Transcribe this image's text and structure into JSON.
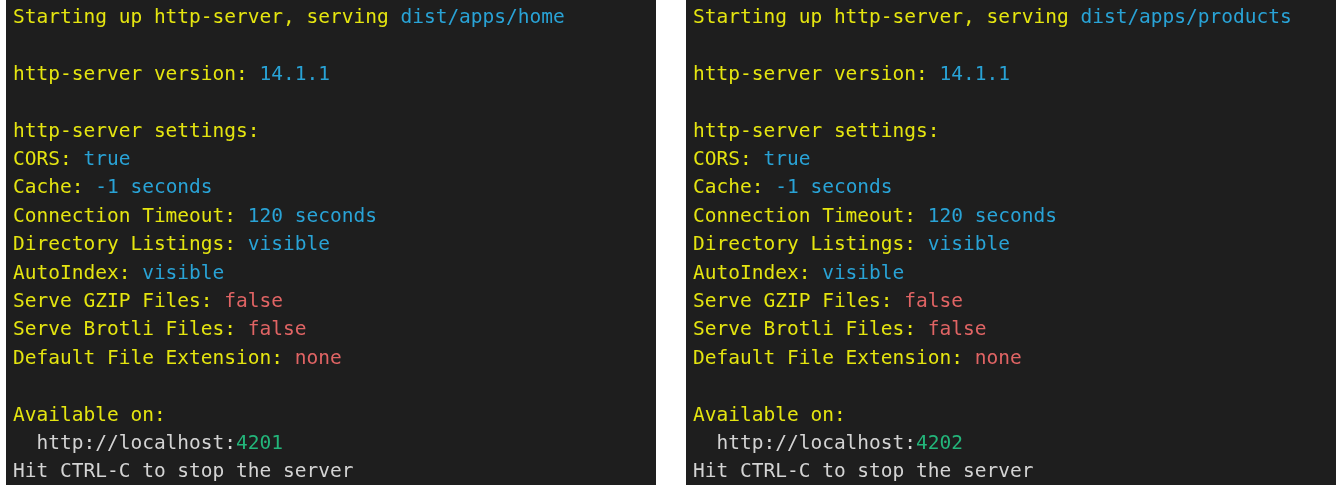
{
  "terminals": [
    {
      "lines": [
        {
          "kind": "text",
          "segments": [
            {
              "text": "Starting up http-server, serving ",
              "kind": "label"
            },
            {
              "text": "dist/apps/home",
              "kind": "value"
            }
          ]
        },
        {
          "kind": "blank"
        },
        {
          "kind": "text",
          "segments": [
            {
              "text": "http-server version: ",
              "kind": "label"
            },
            {
              "text": "14.1.1",
              "kind": "value"
            }
          ]
        },
        {
          "kind": "blank"
        },
        {
          "kind": "text",
          "segments": [
            {
              "text": "http-server settings:",
              "kind": "label"
            }
          ]
        },
        {
          "kind": "text",
          "segments": [
            {
              "text": "CORS: ",
              "kind": "label"
            },
            {
              "text": "true",
              "kind": "value"
            }
          ]
        },
        {
          "kind": "text",
          "segments": [
            {
              "text": "Cache: ",
              "kind": "label"
            },
            {
              "text": "-1 seconds",
              "kind": "value"
            }
          ]
        },
        {
          "kind": "text",
          "segments": [
            {
              "text": "Connection Timeout: ",
              "kind": "label"
            },
            {
              "text": "120 seconds",
              "kind": "value"
            }
          ]
        },
        {
          "kind": "text",
          "segments": [
            {
              "text": "Directory Listings: ",
              "kind": "label"
            },
            {
              "text": "visible",
              "kind": "value"
            }
          ]
        },
        {
          "kind": "text",
          "segments": [
            {
              "text": "AutoIndex: ",
              "kind": "label"
            },
            {
              "text": "visible",
              "kind": "value"
            }
          ]
        },
        {
          "kind": "text",
          "segments": [
            {
              "text": "Serve GZIP Files: ",
              "kind": "label"
            },
            {
              "text": "false",
              "kind": "off"
            }
          ]
        },
        {
          "kind": "text",
          "segments": [
            {
              "text": "Serve Brotli Files: ",
              "kind": "label"
            },
            {
              "text": "false",
              "kind": "off"
            }
          ]
        },
        {
          "kind": "text",
          "segments": [
            {
              "text": "Default File Extension: ",
              "kind": "label"
            },
            {
              "text": "none",
              "kind": "off"
            }
          ]
        },
        {
          "kind": "blank"
        },
        {
          "kind": "text",
          "segments": [
            {
              "text": "Available on:",
              "kind": "label"
            }
          ]
        },
        {
          "kind": "text",
          "segments": [
            {
              "text": "  http://localhost:",
              "kind": "plain"
            },
            {
              "text": "4201",
              "kind": "port"
            }
          ]
        },
        {
          "kind": "text",
          "segments": [
            {
              "text": "Hit CTRL-C to stop the server",
              "kind": "plain"
            }
          ]
        }
      ]
    },
    {
      "lines": [
        {
          "kind": "text",
          "segments": [
            {
              "text": "Starting up http-server, serving ",
              "kind": "label"
            },
            {
              "text": "dist/apps/products",
              "kind": "value"
            }
          ]
        },
        {
          "kind": "blank"
        },
        {
          "kind": "text",
          "segments": [
            {
              "text": "http-server version: ",
              "kind": "label"
            },
            {
              "text": "14.1.1",
              "kind": "value"
            }
          ]
        },
        {
          "kind": "blank"
        },
        {
          "kind": "text",
          "segments": [
            {
              "text": "http-server settings:",
              "kind": "label"
            }
          ]
        },
        {
          "kind": "text",
          "segments": [
            {
              "text": "CORS: ",
              "kind": "label"
            },
            {
              "text": "true",
              "kind": "value"
            }
          ]
        },
        {
          "kind": "text",
          "segments": [
            {
              "text": "Cache: ",
              "kind": "label"
            },
            {
              "text": "-1 seconds",
              "kind": "value"
            }
          ]
        },
        {
          "kind": "text",
          "segments": [
            {
              "text": "Connection Timeout: ",
              "kind": "label"
            },
            {
              "text": "120 seconds",
              "kind": "value"
            }
          ]
        },
        {
          "kind": "text",
          "segments": [
            {
              "text": "Directory Listings: ",
              "kind": "label"
            },
            {
              "text": "visible",
              "kind": "value"
            }
          ]
        },
        {
          "kind": "text",
          "segments": [
            {
              "text": "AutoIndex: ",
              "kind": "label"
            },
            {
              "text": "visible",
              "kind": "value"
            }
          ]
        },
        {
          "kind": "text",
          "segments": [
            {
              "text": "Serve GZIP Files: ",
              "kind": "label"
            },
            {
              "text": "false",
              "kind": "off"
            }
          ]
        },
        {
          "kind": "text",
          "segments": [
            {
              "text": "Serve Brotli Files: ",
              "kind": "label"
            },
            {
              "text": "false",
              "kind": "off"
            }
          ]
        },
        {
          "kind": "text",
          "segments": [
            {
              "text": "Default File Extension: ",
              "kind": "label"
            },
            {
              "text": "none",
              "kind": "off"
            }
          ]
        },
        {
          "kind": "blank"
        },
        {
          "kind": "text",
          "segments": [
            {
              "text": "Available on:",
              "kind": "label"
            }
          ]
        },
        {
          "kind": "text",
          "segments": [
            {
              "text": "  http://localhost:",
              "kind": "plain"
            },
            {
              "text": "4202",
              "kind": "port"
            }
          ]
        },
        {
          "kind": "text",
          "segments": [
            {
              "text": "Hit CTRL-C to stop the server",
              "kind": "plain"
            }
          ]
        }
      ]
    }
  ]
}
